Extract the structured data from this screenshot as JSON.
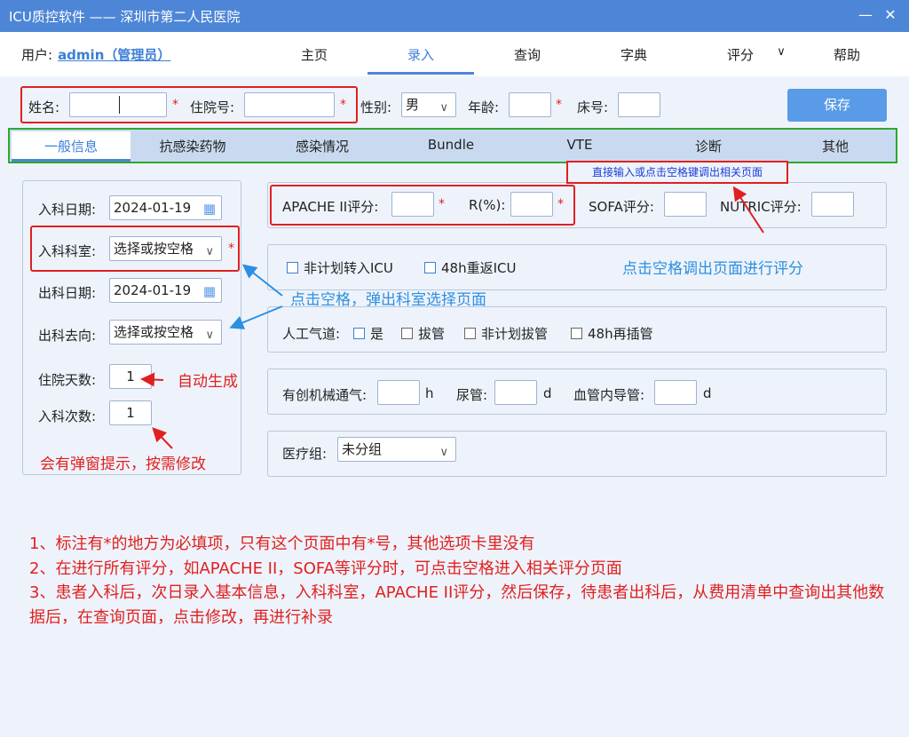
{
  "window": {
    "title": "ICU质控软件 —— 深圳市第二人民医院",
    "min": "—",
    "close": "✕"
  },
  "menubar": {
    "user_label": "用户:",
    "user_name": "admin（管理员）",
    "items": [
      "主页",
      "录入",
      "查询",
      "字典",
      "评分",
      "帮助"
    ],
    "score_chevron": "∨"
  },
  "patient": {
    "name_label": "姓名:",
    "name_value": "",
    "admission_no_label": "住院号:",
    "admission_no_value": "",
    "gender_label": "性别:",
    "gender_value": "男",
    "age_label": "年龄:",
    "age_value": "",
    "bed_label": "床号:",
    "bed_value": "",
    "required_mark": "*"
  },
  "save_label": "保存",
  "tabs": [
    "一般信息",
    "抗感染药物",
    "感染情况",
    "Bundle",
    "VTE",
    "诊断",
    "其他"
  ],
  "left": {
    "admit_date_label": "入科日期:",
    "admit_date_value": "2024-01-19",
    "dept_label": "入科科室:",
    "dept_value": "选择或按空格",
    "discharge_date_label": "出科日期:",
    "discharge_date_value": "2024-01-19",
    "destination_label": "出科去向:",
    "destination_value": "选择或按空格",
    "stay_days_label": "住院天数:",
    "stay_days_value": "1",
    "admit_count_label": "入科次数:",
    "admit_count_value": "1"
  },
  "scores": {
    "apache_label": "APACHE II评分:",
    "apache_value": "",
    "r_label": "R(%):",
    "r_value": "",
    "sofa_label": "SOFA评分:",
    "sofa_value": "",
    "nutric_label": "NUTRIC评分:",
    "nutric_value": ""
  },
  "transfer": {
    "unplanned_label": "非计划转入ICU",
    "return48_label": "48h重返ICU"
  },
  "airway": {
    "label": "人工气道:",
    "opt_yes": "是",
    "opt_extubate": "拔管",
    "opt_unplanned": "非计划拔管",
    "opt_reintubate": "48h再插管"
  },
  "devices": {
    "mech_vent_label": "有创机械通气:",
    "mech_vent_unit": "h",
    "urinary_label": "尿管:",
    "urinary_unit": "d",
    "cvc_label": "血管内导管:",
    "cvc_unit": "d"
  },
  "medical_group": {
    "label": "医疗组:",
    "value": "未分组"
  },
  "annotations": {
    "direct_input": "直接输入或点击空格键调出相关页面",
    "space_score": "点击空格调出页面进行评分",
    "space_dept": "点击空格，弹出科室选择页面",
    "auto_gen": "自动生成",
    "popup_hint": "会有弹窗提示，按需修改",
    "note1": "1、标注有*的地方为必填项，只有这个页面中有*号，其他选项卡里没有",
    "note2": "2、在进行所有评分，如APACHE II，SOFA等评分时，可点击空格进入相关评分页面",
    "note3": "3、患者入科后，次日录入基本信息，入科科室，APACHE II评分，然后保存，待患者出科后，从费用清单中查询出其他数据后，在查询页面，点击修改，再进行补录"
  },
  "icons": {
    "calendar": "calendar-icon",
    "chevron": "chevron-down-icon"
  },
  "colors": {
    "accent": "#4d86d6",
    "annotation_red": "#e02020",
    "annotation_blue": "#2c8fe0",
    "tab_border": "#2ea82e"
  }
}
